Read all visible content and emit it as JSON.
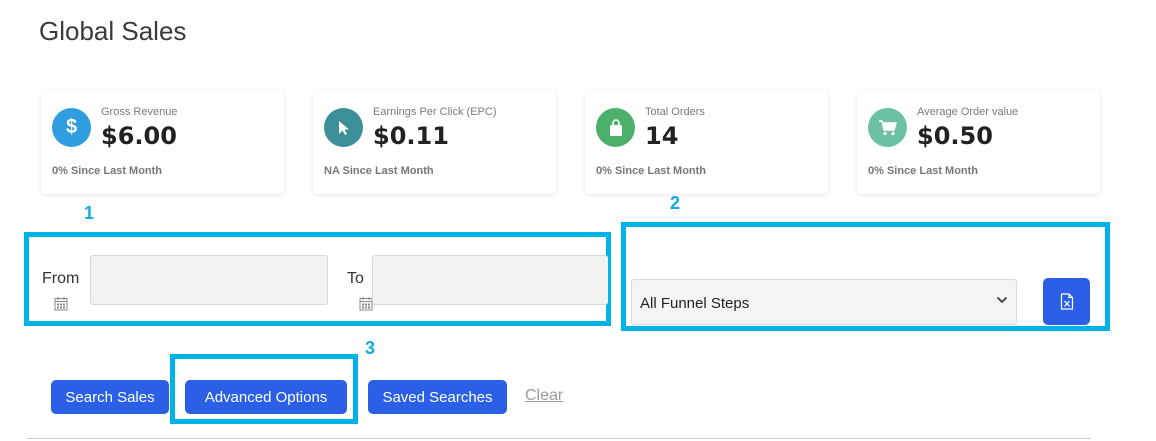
{
  "page": {
    "title": "Global Sales"
  },
  "stats": [
    {
      "label": "Gross Revenue",
      "value": "$6.00",
      "since": "0% Since Last Month",
      "icon": "dollar-icon",
      "color": "#2f9de0"
    },
    {
      "label": "Earnings Per Click (EPC)",
      "value": "$0.11",
      "since": "NA Since Last Month",
      "icon": "cursor-icon",
      "color": "#3b8f99"
    },
    {
      "label": "Total Orders",
      "value": "14",
      "since": "0% Since Last Month",
      "icon": "shopping-bag-icon",
      "color": "#4caf6a"
    },
    {
      "label": "Average Order value",
      "value": "$0.50",
      "since": "0% Since Last Month",
      "icon": "cart-icon",
      "color": "#6cc0a3"
    }
  ],
  "annotations": {
    "one": "1",
    "two": "2",
    "three": "3",
    "color": "#00b3e6"
  },
  "filters": {
    "from_label": "From",
    "to_label": "To",
    "funnel_select": "All Funnel Steps"
  },
  "actions": {
    "search": "Search Sales",
    "advanced": "Advanced Options",
    "saved": "Saved Searches",
    "clear": "Clear"
  },
  "colors": {
    "primary": "#2a5fe6",
    "highlight": "#00b3e6"
  }
}
